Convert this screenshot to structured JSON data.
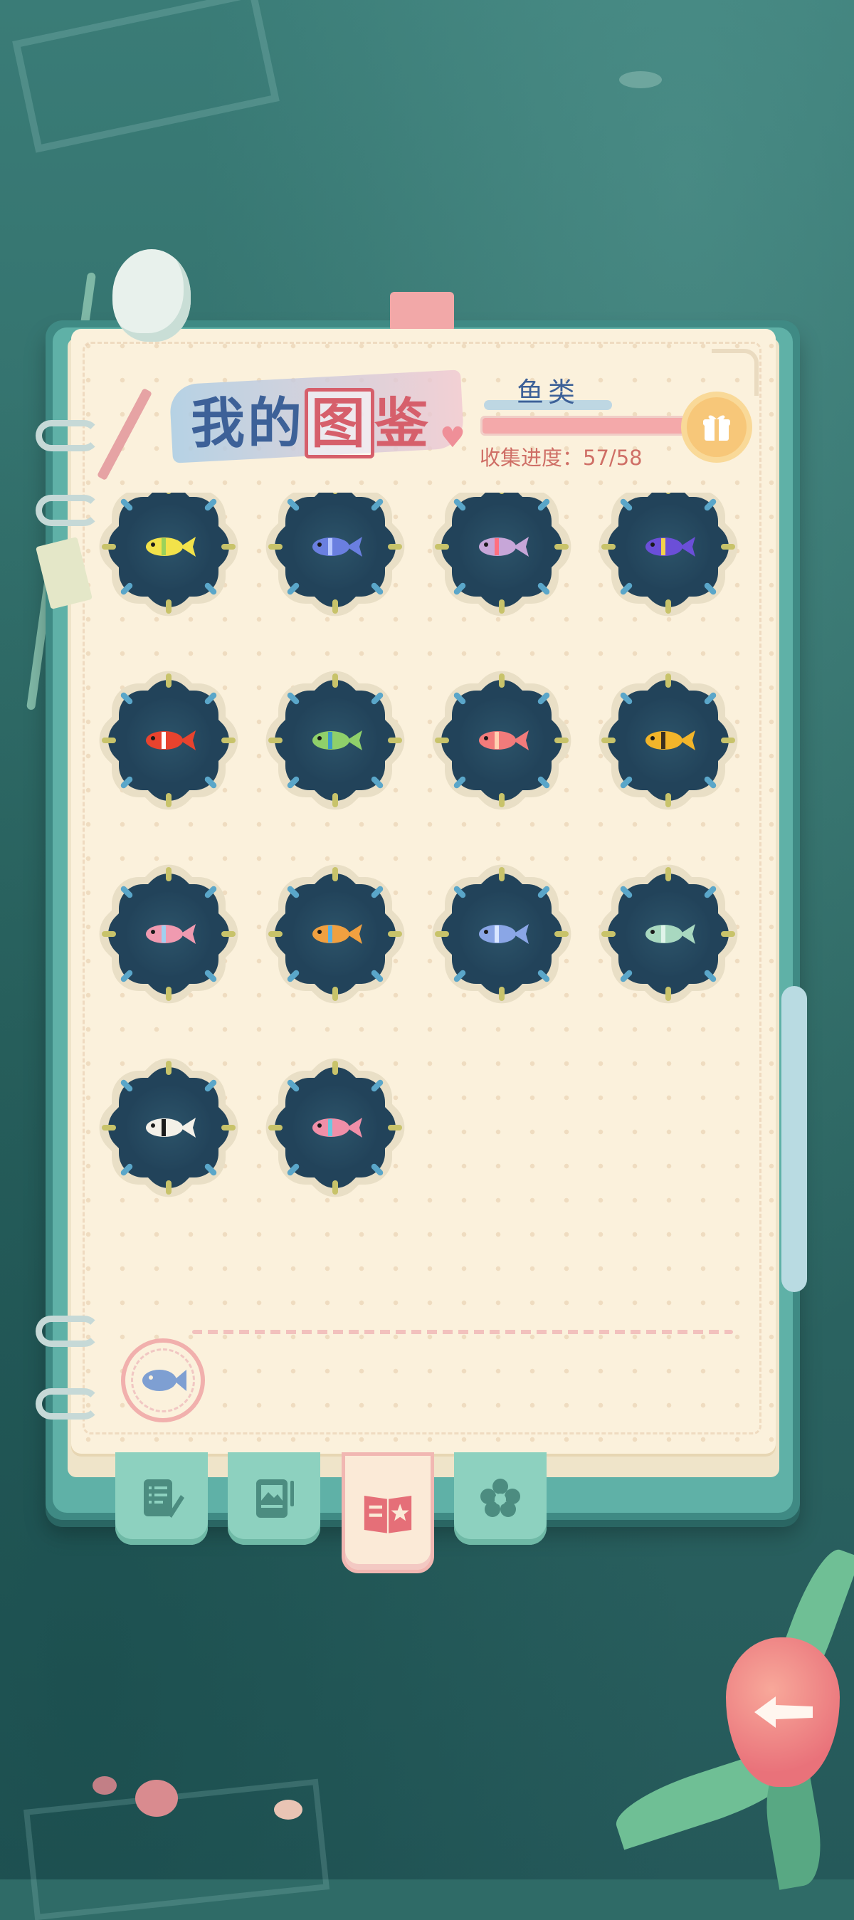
{
  "header": {
    "title_part1": "我的",
    "title_boxed": "图",
    "title_part2": "鉴"
  },
  "category": {
    "label": "鱼类"
  },
  "progress": {
    "label": "收集进度：",
    "collected": 57,
    "total": 58,
    "text": "57/58",
    "fraction": 0.983
  },
  "colors": {
    "accent_pink": "#f4a9aa",
    "title_blue": "#3d6198",
    "badge_navy": "#22435a",
    "page_cream": "#fbf1dc",
    "tab_mint": "#8dd1bf"
  },
  "collection": {
    "items": [
      {
        "name": "yellow-tang-fish",
        "body": "#f2e24a",
        "stripe": "#9ad25a"
      },
      {
        "name": "blue-betta-fish",
        "body": "#6a7fe0",
        "stripe": "#b8c8ff"
      },
      {
        "name": "neon-tetra-fish",
        "body": "#c7a6d8",
        "stripe": "#ff6f7f"
      },
      {
        "name": "purple-dottyback-fish",
        "body": "#6b4fd8",
        "stripe": "#f4d24a"
      },
      {
        "name": "clownfish",
        "body": "#e8432e",
        "stripe": "#ffffff"
      },
      {
        "name": "green-parrotfish",
        "body": "#8fd06a",
        "stripe": "#3a9ac8"
      },
      {
        "name": "pink-goldfish",
        "body": "#f27b7b",
        "stripe": "#ffd0b0"
      },
      {
        "name": "yellow-boxfish",
        "body": "#f2b52a",
        "stripe": "#3a3020"
      },
      {
        "name": "pink-tetra-fish",
        "body": "#f09ab0",
        "stripe": "#a0d0f0"
      },
      {
        "name": "rainbow-fish",
        "body": "#f0a040",
        "stripe": "#5ab0e0"
      },
      {
        "name": "blue-dory-fish",
        "body": "#8aa6e6",
        "stripe": "#d8e6ff"
      },
      {
        "name": "leafy-seadragon",
        "body": "#a8d8c0",
        "stripe": "#e0f4ea"
      },
      {
        "name": "banggai-cardinalfish",
        "body": "#f4f0e8",
        "stripe": "#1a1a1a"
      },
      {
        "name": "pink-blue-flyingfish",
        "body": "#f08fa8",
        "stripe": "#6ac8e0"
      }
    ]
  },
  "filter": {
    "icon": "fish-filter-icon"
  },
  "tabs": [
    {
      "name": "tab-notes",
      "icon": "notepad-pencil-icon",
      "active": false
    },
    {
      "name": "tab-album",
      "icon": "photo-album-icon",
      "active": false
    },
    {
      "name": "tab-encyclopedia",
      "icon": "open-book-star-icon",
      "active": true
    },
    {
      "name": "tab-decoration",
      "icon": "flower-icon",
      "active": false
    }
  ],
  "back": {
    "icon": "back-arrow-icon"
  }
}
